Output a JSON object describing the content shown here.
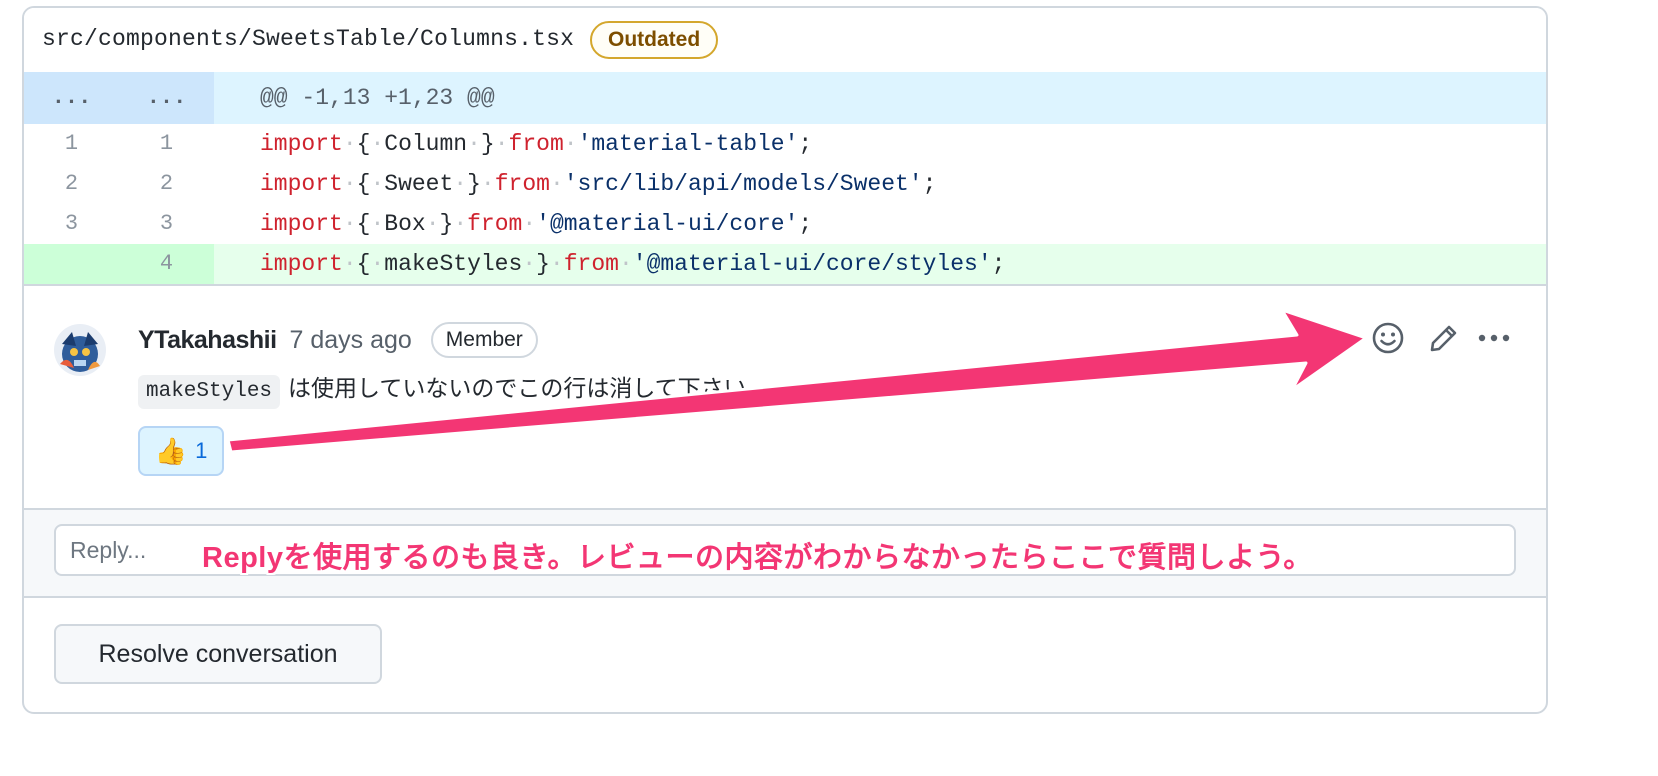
{
  "file": {
    "path": "src/components/SweetsTable/Columns.tsx",
    "status_badge": "Outdated"
  },
  "diff": {
    "hunk": {
      "old_marker": "...",
      "new_marker": "...",
      "header": "@@ -1,13 +1,23 @@"
    },
    "lines": [
      {
        "old": "1",
        "new": "1",
        "type": "context",
        "tokens": [
          [
            "kw",
            "import"
          ],
          [
            "ws",
            "·"
          ],
          [
            "p",
            "{"
          ],
          [
            "ws",
            "·"
          ],
          [
            "p",
            "Column"
          ],
          [
            "ws",
            "·"
          ],
          [
            "p",
            "}"
          ],
          [
            "ws",
            "·"
          ],
          [
            "kw",
            "from"
          ],
          [
            "ws",
            "·"
          ],
          [
            "str",
            "'material-table'"
          ],
          [
            "p",
            ";"
          ]
        ]
      },
      {
        "old": "2",
        "new": "2",
        "type": "context",
        "tokens": [
          [
            "kw",
            "import"
          ],
          [
            "ws",
            "·"
          ],
          [
            "p",
            "{"
          ],
          [
            "ws",
            "·"
          ],
          [
            "p",
            "Sweet"
          ],
          [
            "ws",
            "·"
          ],
          [
            "p",
            "}"
          ],
          [
            "ws",
            "·"
          ],
          [
            "kw",
            "from"
          ],
          [
            "ws",
            "·"
          ],
          [
            "str",
            "'src/lib/api/models/Sweet'"
          ],
          [
            "p",
            ";"
          ]
        ]
      },
      {
        "old": "3",
        "new": "3",
        "type": "context",
        "tokens": [
          [
            "kw",
            "import"
          ],
          [
            "ws",
            "·"
          ],
          [
            "p",
            "{"
          ],
          [
            "ws",
            "·"
          ],
          [
            "p",
            "Box"
          ],
          [
            "ws",
            "·"
          ],
          [
            "p",
            "}"
          ],
          [
            "ws",
            "·"
          ],
          [
            "kw",
            "from"
          ],
          [
            "ws",
            "·"
          ],
          [
            "str",
            "'@material-ui/core'"
          ],
          [
            "p",
            ";"
          ]
        ]
      },
      {
        "old": "",
        "new": "4",
        "type": "added",
        "tokens": [
          [
            "kw",
            "import"
          ],
          [
            "ws",
            "·"
          ],
          [
            "p",
            "{"
          ],
          [
            "ws",
            "·"
          ],
          [
            "p",
            "makeStyles"
          ],
          [
            "ws",
            "·"
          ],
          [
            "p",
            "}"
          ],
          [
            "ws",
            "·"
          ],
          [
            "kw",
            "from"
          ],
          [
            "ws",
            "·"
          ],
          [
            "str",
            "'@material-ui/core/styles'"
          ],
          [
            "p",
            ";"
          ]
        ]
      }
    ]
  },
  "comment": {
    "author": "YTakahashii",
    "timestamp": "7 days ago",
    "role_badge": "Member",
    "body_code": "makeStyles",
    "body_text": "は使用していないのでこの行は消して下さい",
    "reaction": {
      "emoji": "👍",
      "count": "1"
    },
    "actions": [
      "smiley-icon",
      "pencil-icon",
      "kebab-horizontal-icon"
    ]
  },
  "reply": {
    "placeholder": "Reply..."
  },
  "resolve": {
    "label": "Resolve conversation"
  },
  "annotation": {
    "text": "Replyを使用するのも良き。レビューの内容がわからなかったらここで質問しよう。",
    "color": "#f33674"
  },
  "colors": {
    "border": "#d0d7de",
    "hunk_bg": "#ddf4ff",
    "added_bg": "#e6ffec",
    "keyword": "#cf222e",
    "string": "#0a3069",
    "outdated": "#d4a72c"
  }
}
